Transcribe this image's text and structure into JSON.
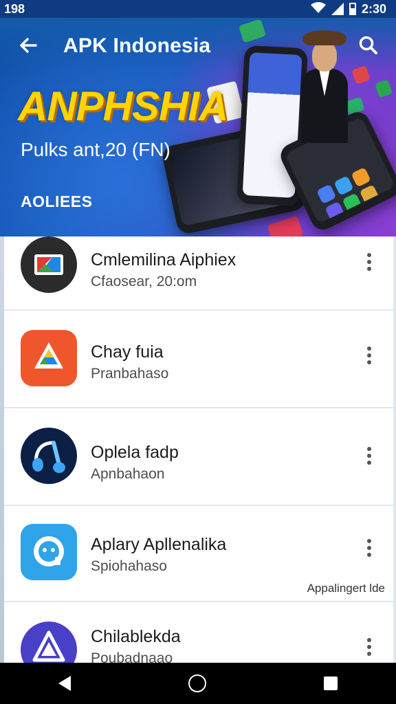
{
  "status_bar": {
    "time_left": "198",
    "time_right": "2:30"
  },
  "app_bar": {
    "title": "APK Indonesia",
    "back_icon": "back-arrow-icon",
    "search_icon": "search-icon"
  },
  "banner": {
    "headline": "ANPHSHIA",
    "subline": "Pulks ant,20 (FN)",
    "section_label": "AOLIEES"
  },
  "apps": [
    {
      "name": "Cmlemilina Aiphiex",
      "subtitle": "Cfaosear, 20:om",
      "icon": "image-gallery-icon"
    },
    {
      "name": "Chay fuia",
      "subtitle": "Pranbahaso",
      "icon": "drive-triangle-icon"
    },
    {
      "name": "Oplela fadp",
      "subtitle": "Apnbahaon",
      "icon": "headphones-icon"
    },
    {
      "name": "Aplary Apllenalika",
      "subtitle": "Spiohahaso",
      "icon": "chat-bubble-icon"
    },
    {
      "name": "Chilablekda",
      "subtitle": "Poubadnaao",
      "icon": "triangle-logo-icon"
    }
  ],
  "side_note": "Appalingert lde",
  "colors": {
    "status_bar": "#0f3c80",
    "headline_yellow": "#ffd400",
    "list_bg": "#ffffff"
  }
}
